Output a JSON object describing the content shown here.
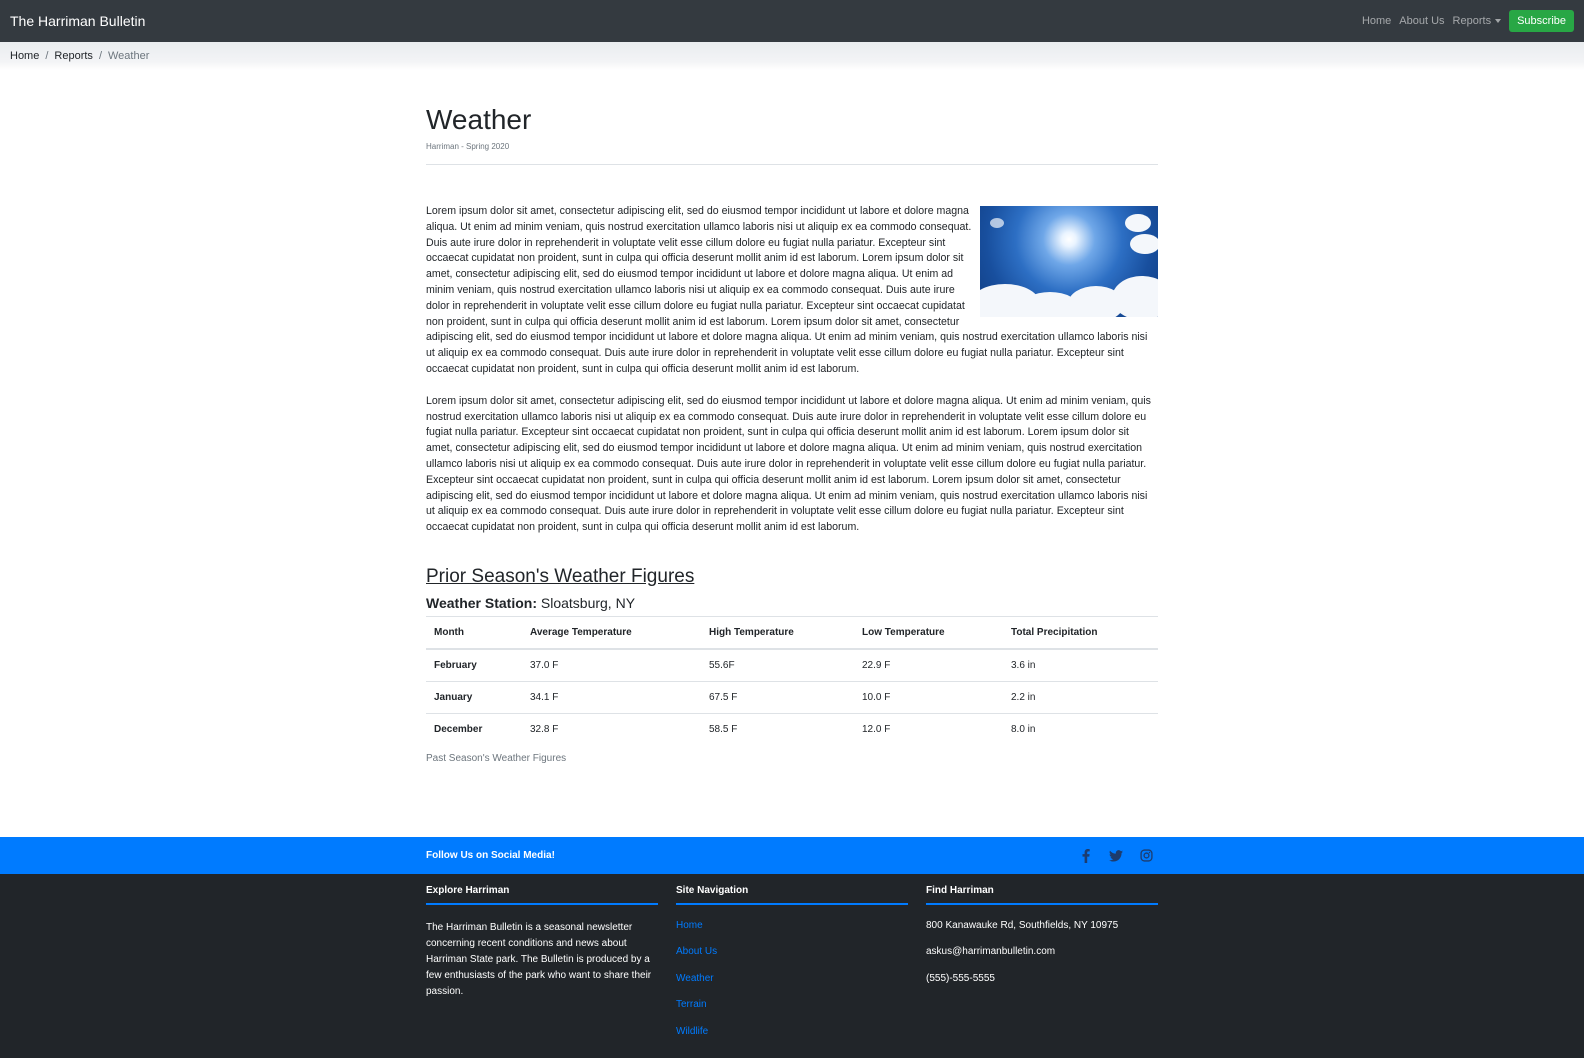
{
  "navbar": {
    "brand": "The Harriman Bulletin",
    "links": [
      "Home",
      "About Us"
    ],
    "dropdown_label": "Reports",
    "subscribe_label": "Subscribe"
  },
  "breadcrumb": {
    "home": "Home",
    "reports": "Reports",
    "current": "Weather"
  },
  "page": {
    "title": "Weather",
    "subtitle": "Harriman - Spring 2020"
  },
  "article": {
    "paragraph1": "Lorem ipsum dolor sit amet, consectetur adipiscing elit, sed do eiusmod tempor incididunt ut labore et dolore magna aliqua. Ut enim ad minim veniam, quis nostrud exercitation ullamco laboris nisi ut aliquip ex ea commodo consequat. Duis aute irure dolor in reprehenderit in voluptate velit esse cillum dolore eu fugiat nulla pariatur. Excepteur sint occaecat cupidatat non proident, sunt in culpa qui officia deserunt mollit anim id est laborum. Lorem ipsum dolor sit amet, consectetur adipiscing elit, sed do eiusmod tempor incididunt ut labore et dolore magna aliqua. Ut enim ad minim veniam, quis nostrud exercitation ullamco laboris nisi ut aliquip ex ea commodo consequat. Duis aute irure dolor in reprehenderit in voluptate velit esse cillum dolore eu fugiat nulla pariatur. Excepteur sint occaecat cupidatat non proident, sunt in culpa qui officia deserunt mollit anim id est laborum. Lorem ipsum dolor sit amet, consectetur adipiscing elit, sed do eiusmod tempor incididunt ut labore et dolore magna aliqua. Ut enim ad minim veniam, quis nostrud exercitation ullamco laboris nisi ut aliquip ex ea commodo consequat. Duis aute irure dolor in reprehenderit in voluptate velit esse cillum dolore eu fugiat nulla pariatur. Excepteur sint occaecat cupidatat non proident, sunt in culpa qui officia deserunt mollit anim id est laborum.",
    "paragraph2": "Lorem ipsum dolor sit amet, consectetur adipiscing elit, sed do eiusmod tempor incididunt ut labore et dolore magna aliqua. Ut enim ad minim veniam, quis nostrud exercitation ullamco laboris nisi ut aliquip ex ea commodo consequat. Duis aute irure dolor in reprehenderit in voluptate velit esse cillum dolore eu fugiat nulla pariatur. Excepteur sint occaecat cupidatat non proident, sunt in culpa qui officia deserunt mollit anim id est laborum. Lorem ipsum dolor sit amet, consectetur adipiscing elit, sed do eiusmod tempor incididunt ut labore et dolore magna aliqua. Ut enim ad minim veniam, quis nostrud exercitation ullamco laboris nisi ut aliquip ex ea commodo consequat. Duis aute irure dolor in reprehenderit in voluptate velit esse cillum dolore eu fugiat nulla pariatur. Excepteur sint occaecat cupidatat non proident, sunt in culpa qui officia deserunt mollit anim id est laborum. Lorem ipsum dolor sit amet, consectetur adipiscing elit, sed do eiusmod tempor incididunt ut labore et dolore magna aliqua. Ut enim ad minim veniam, quis nostrud exercitation ullamco laboris nisi ut aliquip ex ea commodo consequat. Duis aute irure dolor in reprehenderit in voluptate velit esse cillum dolore eu fugiat nulla pariatur. Excepteur sint occaecat cupidatat non proident, sunt in culpa qui officia deserunt mollit anim id est laborum."
  },
  "figures": {
    "section_title": "Prior Season's Weather Figures",
    "station_label": "Weather Station:",
    "station_value": "Sloatsburg, NY",
    "headers": [
      "Month",
      "Average Temperature",
      "High Temperature",
      "Low Temperature",
      "Total Precipitation"
    ],
    "rows": [
      [
        "February",
        "37.0 F",
        "55.6F",
        "22.9 F",
        "3.6 in"
      ],
      [
        "January",
        "34.1 F",
        "67.5 F",
        "10.0 F",
        "2.2 in"
      ],
      [
        "December",
        "32.8 F",
        "58.5 F",
        "12.0 F",
        "8.0 in"
      ]
    ],
    "caption": "Past Season's Weather Figures"
  },
  "social": {
    "text": "Follow Us on Social Media!",
    "icons": [
      "facebook-icon",
      "twitter-icon",
      "instagram-icon"
    ]
  },
  "footer": {
    "explore_title": "Explore Harriman",
    "explore_text": "The Harriman Bulletin is a seasonal newsletter concerning recent conditions and news about Harriman State park. The Bulletin is produced by a few enthusiasts of the park who want to share their passion.",
    "nav_title": "Site Navigation",
    "nav_links": [
      "Home",
      "About Us",
      "Weather",
      "Terrain",
      "Wildlife"
    ],
    "find_title": "Find Harriman",
    "address": "800 Kanawauke Rd, Southfields, NY 10975",
    "email": "askus@harrimanbulletin.com",
    "phone": "(555)-555-5555"
  },
  "colors": {
    "navbar": "#343a40",
    "subscribe": "#28a745",
    "accent": "#007bff",
    "footer": "#212529"
  }
}
